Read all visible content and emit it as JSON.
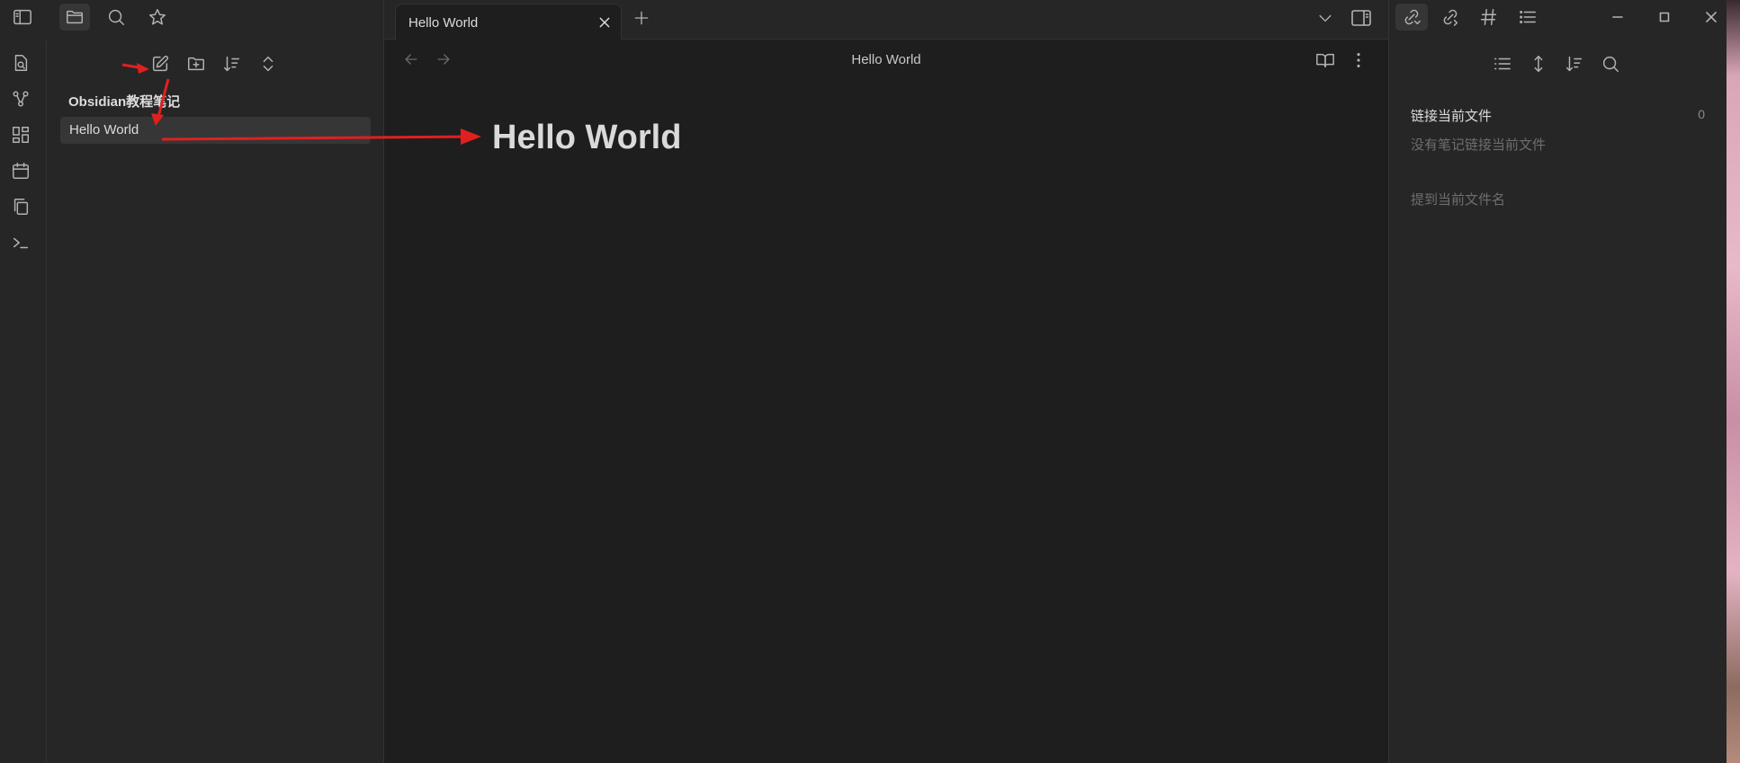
{
  "window": {
    "title": "Hello World"
  },
  "tabs": [
    {
      "label": "Hello World"
    }
  ],
  "explorer": {
    "folder": "Obsidian教程笔记",
    "files": [
      {
        "name": "Hello World"
      }
    ]
  },
  "editor": {
    "view_title": "Hello World",
    "heading": "Hello World"
  },
  "backlinks": {
    "linked_title": "链接当前文件",
    "linked_count": "0",
    "linked_empty": "没有笔记链接当前文件",
    "unlinked_title": "提到当前文件名"
  },
  "colors": {
    "background": "#1e1e1e",
    "panel": "#262626",
    "annotation_arrow": "#e02020"
  },
  "icons": [
    "sidebar-left-icon",
    "folder-icon",
    "search-icon",
    "bookmark-star-icon",
    "quick-switcher-icon",
    "graph-icon",
    "canvas-icon",
    "calendar-icon",
    "copy-icon",
    "terminal-icon",
    "new-note-icon",
    "new-folder-icon",
    "sort-icon",
    "collapse-icon",
    "close-icon",
    "plus-icon",
    "chevron-down-icon",
    "sidebar-right-icon",
    "arrow-left-icon",
    "arrow-right-icon",
    "book-open-icon",
    "more-vertical-icon",
    "backlinks-icon",
    "outgoing-links-icon",
    "tag-icon",
    "outline-icon",
    "minimize-icon",
    "maximize-icon",
    "window-close-icon",
    "list-icon",
    "expand-vertical-icon"
  ]
}
